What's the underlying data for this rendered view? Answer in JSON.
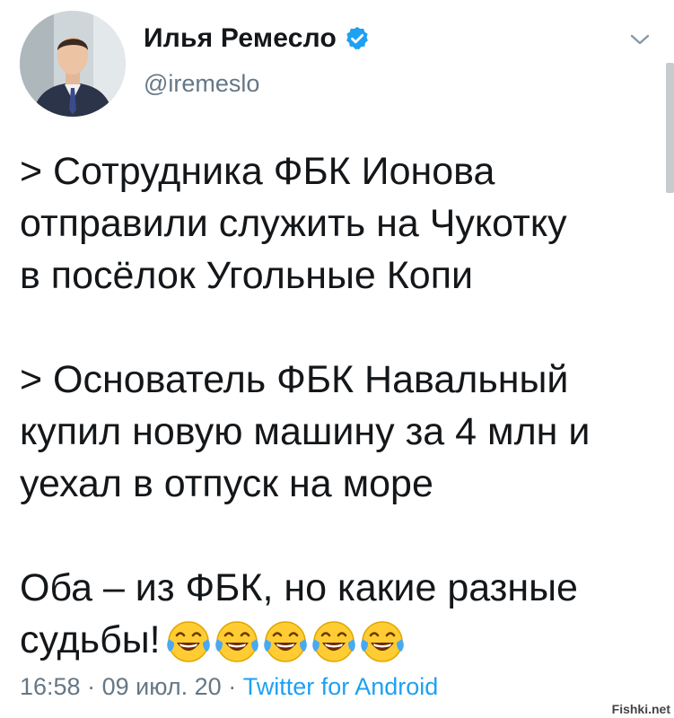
{
  "author": {
    "display_name": "Илья Ремесло",
    "handle": "@iremeslo",
    "verified": true
  },
  "tweet": {
    "para1_line1": "> Сотрудника ФБК Ионова",
    "para1_line2": "отправили служить на Чукотку",
    "para1_line3": "в посёлок Угольные Копи",
    "para2_line1": "> Основатель ФБК Навальный",
    "para2_line2": "купил новую машину за 4 млн и",
    "para2_line3": "уехал в отпуск на море",
    "para3_line1": "Оба – из ФБК, но какие разные",
    "para3_line2": "судьбы!",
    "emoji_count": 5,
    "emoji_name": "face-with-tears-of-joy-icon"
  },
  "meta": {
    "time": "16:58",
    "separator": "·",
    "date": "09 июл. 20",
    "source": "Twitter for Android"
  },
  "watermark": "Fishki.net",
  "colors": {
    "text": "#14171a",
    "secondary": "#657786",
    "link": "#1da1f2",
    "verified": "#1da1f2"
  }
}
